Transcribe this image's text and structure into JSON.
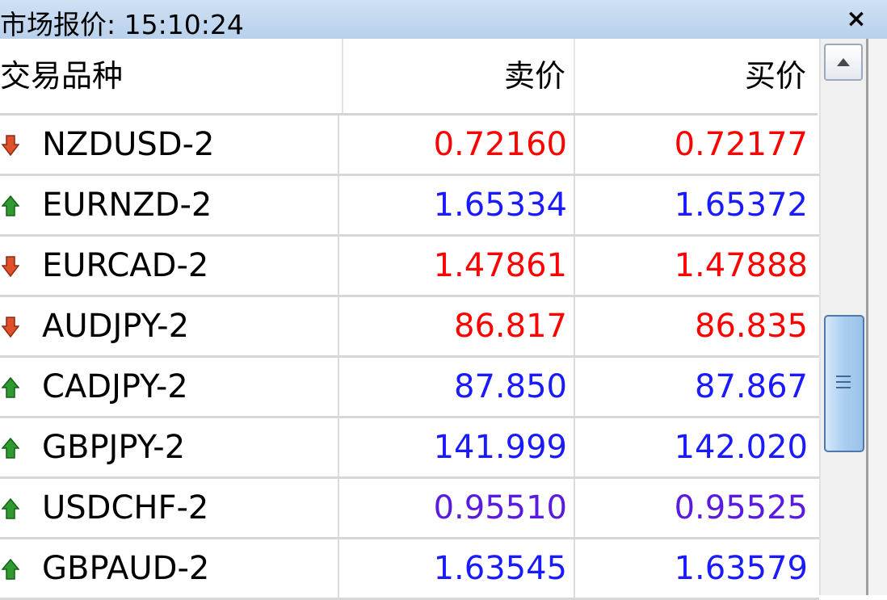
{
  "window": {
    "title": "市场报价: 15:10:24",
    "close_label": "×"
  },
  "columns": {
    "symbol": "交易品种",
    "bid": "卖价",
    "ask": "买价"
  },
  "colors": {
    "down": "#ff0000",
    "up": "#1a1aff",
    "up_alt": "#5a1ae0"
  },
  "rows": [
    {
      "symbol": "NZDUSD-2",
      "bid": "0.72160",
      "ask": "0.72177",
      "direction": "down",
      "icon": "arrow-down-icon"
    },
    {
      "symbol": "EURNZD-2",
      "bid": "1.65334",
      "ask": "1.65372",
      "direction": "up",
      "icon": "arrow-up-icon"
    },
    {
      "symbol": "EURCAD-2",
      "bid": "1.47861",
      "ask": "1.47888",
      "direction": "down",
      "icon": "arrow-down-icon"
    },
    {
      "symbol": "AUDJPY-2",
      "bid": "86.817",
      "ask": "86.835",
      "direction": "down",
      "icon": "arrow-down-icon"
    },
    {
      "symbol": "CADJPY-2",
      "bid": "87.850",
      "ask": "87.867",
      "direction": "up",
      "icon": "arrow-up-icon"
    },
    {
      "symbol": "GBPJPY-2",
      "bid": "141.999",
      "ask": "142.020",
      "direction": "up",
      "icon": "arrow-up-icon"
    },
    {
      "symbol": "USDCHF-2",
      "bid": "0.95510",
      "ask": "0.95525",
      "direction": "up_alt",
      "icon": "arrow-up-icon"
    },
    {
      "symbol": "GBPAUD-2",
      "bid": "1.63545",
      "ask": "1.63579",
      "direction": "up",
      "icon": "arrow-up-icon"
    }
  ]
}
